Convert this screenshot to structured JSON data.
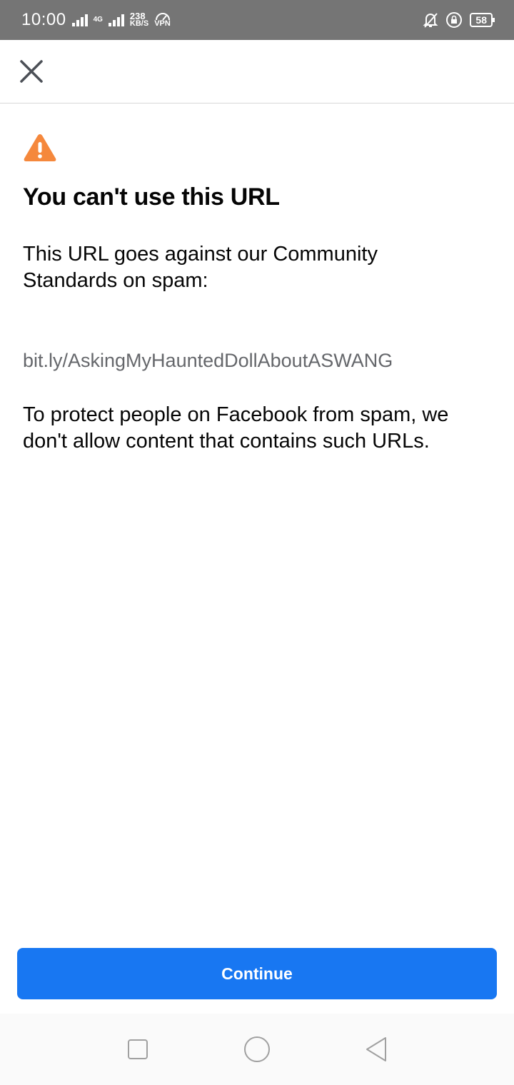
{
  "status_bar": {
    "time": "10:00",
    "network_type": "4G",
    "speed_value": "238",
    "speed_unit": "KB/S",
    "vpn_label": "VPN",
    "battery": "58"
  },
  "dialog": {
    "title": "You can't use this URL",
    "description": "This URL goes against our Community Standards on spam:",
    "url": "bit.ly/AskingMyHauntedDollAboutASWANG",
    "note": "To protect people on Facebook from spam, we don't allow content that contains such URLs.",
    "continue_label": "Continue"
  },
  "colors": {
    "accent": "#1877f2",
    "warning": "#f5883c",
    "status_bar_bg": "#757575"
  },
  "icons": {
    "close": "close-icon",
    "warning": "warning-icon",
    "nav_recent": "square-icon",
    "nav_home": "circle-icon",
    "nav_back": "triangle-back-icon"
  }
}
